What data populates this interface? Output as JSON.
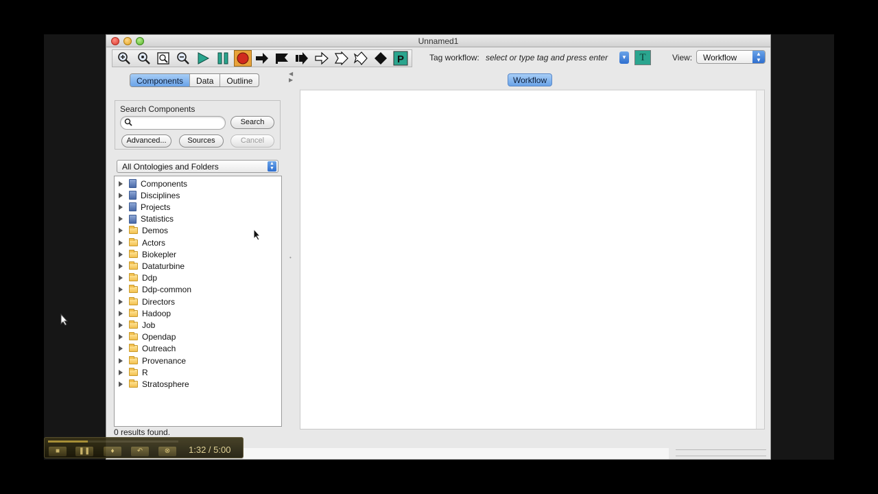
{
  "window": {
    "title": "Unnamed1"
  },
  "toolbar": {
    "icons": [
      "zoom-in-icon",
      "zoom-reset-icon",
      "zoom-fit-icon",
      "zoom-out-icon",
      "run-icon",
      "pause-icon",
      "stop-icon",
      "step-arrow-icon",
      "flag-icon",
      "step-forward-icon",
      "double-arrow-icon",
      "outline-arrow-icon",
      "zigzag-arrow-icon",
      "diamond-icon",
      "p-icon"
    ],
    "tag_label": "Tag workflow:",
    "tag_placeholder": "select or type tag and press enter",
    "tag_button": "T",
    "view_label": "View:",
    "view_value": "Workflow"
  },
  "left": {
    "tabs": [
      "Components",
      "Data",
      "Outline"
    ],
    "active_tab": "Components",
    "search_title": "Search Components",
    "search_value": "",
    "search_button": "Search",
    "advanced_button": "Advanced...",
    "sources_button": "Sources",
    "cancel_button": "Cancel",
    "ontology_select": "All Ontologies and Folders",
    "tree": [
      {
        "label": "Components",
        "icon": "book"
      },
      {
        "label": "Disciplines",
        "icon": "book"
      },
      {
        "label": "Projects",
        "icon": "book"
      },
      {
        "label": "Statistics",
        "icon": "book"
      },
      {
        "label": "Demos",
        "icon": "folder"
      },
      {
        "label": "Actors",
        "icon": "folder"
      },
      {
        "label": "Biokepler",
        "icon": "folder"
      },
      {
        "label": "Dataturbine",
        "icon": "folder"
      },
      {
        "label": "Ddp",
        "icon": "folder"
      },
      {
        "label": "Ddp-common",
        "icon": "folder"
      },
      {
        "label": "Directors",
        "icon": "folder"
      },
      {
        "label": "Hadoop",
        "icon": "folder"
      },
      {
        "label": "Job",
        "icon": "folder"
      },
      {
        "label": "Opendap",
        "icon": "folder"
      },
      {
        "label": "Outreach",
        "icon": "folder"
      },
      {
        "label": "Provenance",
        "icon": "folder"
      },
      {
        "label": "R",
        "icon": "folder"
      },
      {
        "label": "Stratosphere",
        "icon": "folder"
      }
    ],
    "status": "0 results found."
  },
  "right": {
    "tab": "Workflow"
  },
  "player": {
    "time": "1:32 / 5:00",
    "progress": 0.307
  },
  "colors": {
    "accent": "#6aa3e8",
    "tag_button": "#2ba58f",
    "stop": "#d02a1e"
  }
}
